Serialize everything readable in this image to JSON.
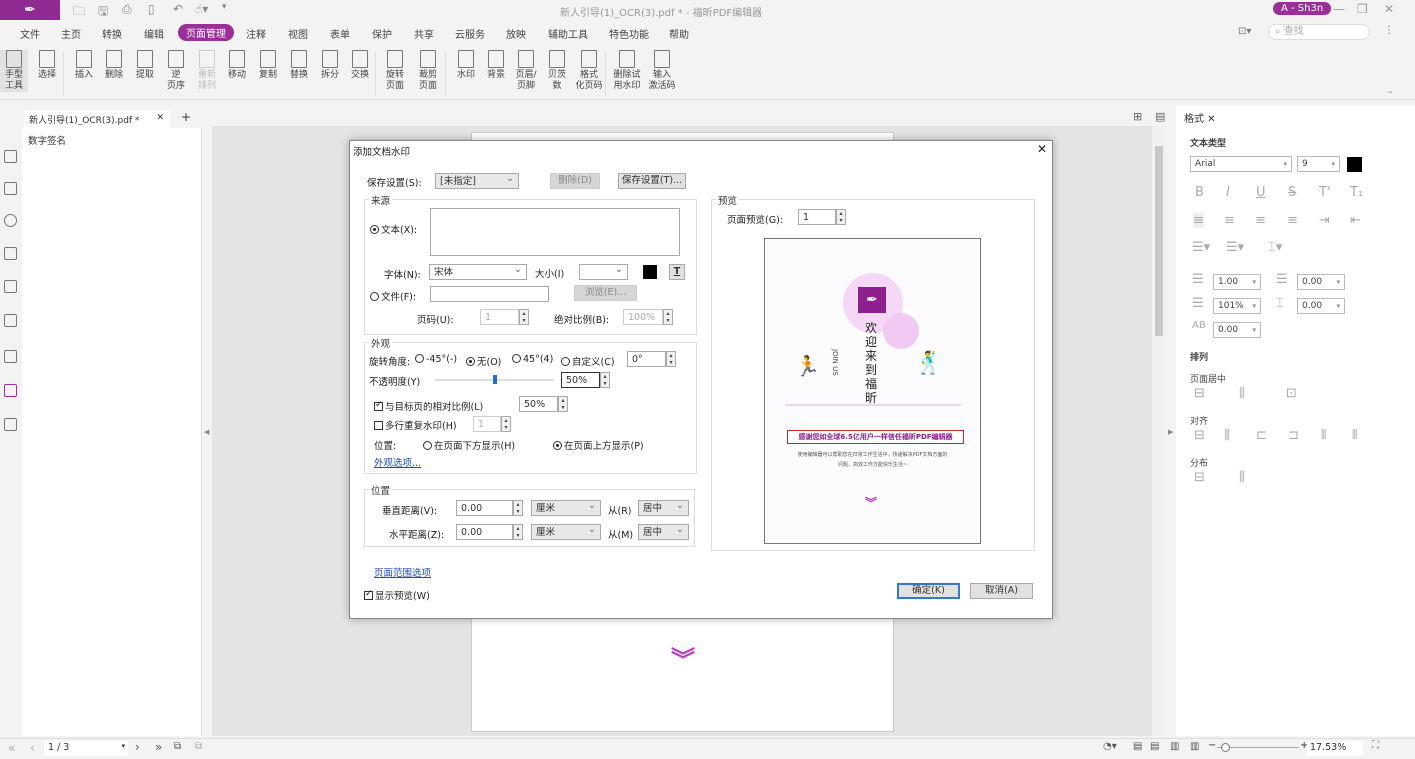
{
  "app": {
    "title": "新人引导(1)_OCR(3).pdf * - 福昕PDF编辑器",
    "user": "A - Sh3n",
    "search_placeholder": "查找"
  },
  "menu": [
    "文件",
    "主页",
    "转换",
    "编辑",
    "页面管理",
    "注释",
    "视图",
    "表单",
    "保护",
    "共享",
    "云服务",
    "放映",
    "辅助工具",
    "特色功能",
    "帮助"
  ],
  "active_menu": "页面管理",
  "ribbon": [
    {
      "label": "手型\n工具",
      "icon": "hand-icon"
    },
    {
      "label": "选择",
      "icon": "select-text-icon"
    },
    {
      "label": "插入",
      "icon": "insert-page-icon"
    },
    {
      "label": "删除",
      "icon": "delete-page-icon"
    },
    {
      "label": "提取",
      "icon": "extract-page-icon"
    },
    {
      "label": "逆\n页序",
      "icon": "reverse-order-icon"
    },
    {
      "label": "重新\n排列",
      "icon": "rearrange-icon",
      "disabled": true
    },
    {
      "label": "移动",
      "icon": "move-page-icon"
    },
    {
      "label": "复制",
      "icon": "copy-page-icon"
    },
    {
      "label": "替换",
      "icon": "replace-page-icon"
    },
    {
      "label": "拆分",
      "icon": "split-icon"
    },
    {
      "label": "交换",
      "icon": "swap-icon"
    },
    {
      "label": "旋转\n页面",
      "icon": "rotate-page-icon"
    },
    {
      "label": "裁剪\n页面",
      "icon": "crop-page-icon"
    },
    {
      "label": "水印",
      "icon": "watermark-icon"
    },
    {
      "label": "背景",
      "icon": "background-icon"
    },
    {
      "label": "页眉/\n页脚",
      "icon": "header-footer-icon"
    },
    {
      "label": "贝茨\n数",
      "icon": "bates-icon"
    },
    {
      "label": "格式\n化页码",
      "icon": "page-number-format-icon"
    },
    {
      "label": "删除试\n用水印",
      "icon": "remove-trial-watermark-icon"
    },
    {
      "label": "输入\n激活码",
      "icon": "activation-key-icon"
    }
  ],
  "doc_tab": "新人引导(1)_OCR(3).pdf *",
  "left_panel_title": "数字签名",
  "dialog": {
    "title": "添加文档水印",
    "save_settings_label": "保存设置(S):",
    "save_settings_value": "[未指定]",
    "delete_btn": "删除(D)",
    "save_btn": "保存设置(T)...",
    "source": {
      "title": "来源",
      "text_radio": "文本(X):",
      "text_value": "",
      "font_label": "字体(N):",
      "font_value": "宋体",
      "size_label": "大小(I)",
      "size_value": "",
      "text_color": "#000000",
      "file_radio": "文件(F):",
      "file_value": "",
      "browse_btn": "浏览(E)...",
      "page_label": "页码(U):",
      "page_value": "1",
      "scale_label": "绝对比例(B):",
      "scale_value": "100%"
    },
    "appearance": {
      "title": "外观",
      "rotation_label": "旋转角度:",
      "rot_options": [
        "-45°(-)",
        "无(O)",
        "45°(4)",
        "自定义(C)"
      ],
      "rot_selected": "无(O)",
      "rot_value": "0°",
      "opacity_label": "不透明度(Y)",
      "opacity_value": "50%",
      "opacity_fraction": 0.5,
      "relative_label": "与目标页的相对比例(L)",
      "relative_checked": true,
      "relative_value": "50%",
      "multiline_label": "多行重复水印(H)",
      "multiline_checked": false,
      "multiline_value": "1",
      "position_label": "位置:",
      "pos_below": "在页面下方显示(H)",
      "pos_above": "在页面上方显示(P)",
      "options_link": "外观选项..."
    },
    "position": {
      "title": "位置",
      "v_label": "垂直距离(V):",
      "v_value": "0.00",
      "v_unit": "厘米",
      "v_from_label": "从(R)",
      "v_from": "居中",
      "h_label": "水平距离(Z):",
      "h_value": "0.00",
      "h_unit": "厘米",
      "h_from_label": "从(M)",
      "h_from": "居中"
    },
    "page_range_link": "页面范围选项",
    "show_preview": "显示预览(W)",
    "preview": {
      "title": "预览",
      "page_label": "页面预览(G):",
      "page_value": "1",
      "heading": "欢迎来到福昕",
      "sub": "JOIN US",
      "banner": "感谢您如全球6.5亿用户一样信任福昕PDF编辑器",
      "desc1": "使用编辑器可以帮助您在日常工作生活中，快速解决PDF文档方面的",
      "desc2": "问题，高效工作方能快乐生活~"
    },
    "ok_btn": "确定(K)",
    "cancel_btn": "取消(A)"
  },
  "format_panel": {
    "tab": "格式",
    "text_type": "文本类型",
    "font": "Arial",
    "size": "9",
    "color": "#000000",
    "line_spacing": "1.00",
    "para_spacing": "0.00",
    "scale": "101%",
    "indent": "0.00",
    "char_spacing": "0.00",
    "arrange": "排列",
    "page_center": "页面居中",
    "align": "对齐",
    "distribute": "分布"
  },
  "status": {
    "page": "1 / 3",
    "zoom": "17.53%",
    "zoom_fraction": 0.1
  },
  "brand_color": "#9b2f99"
}
